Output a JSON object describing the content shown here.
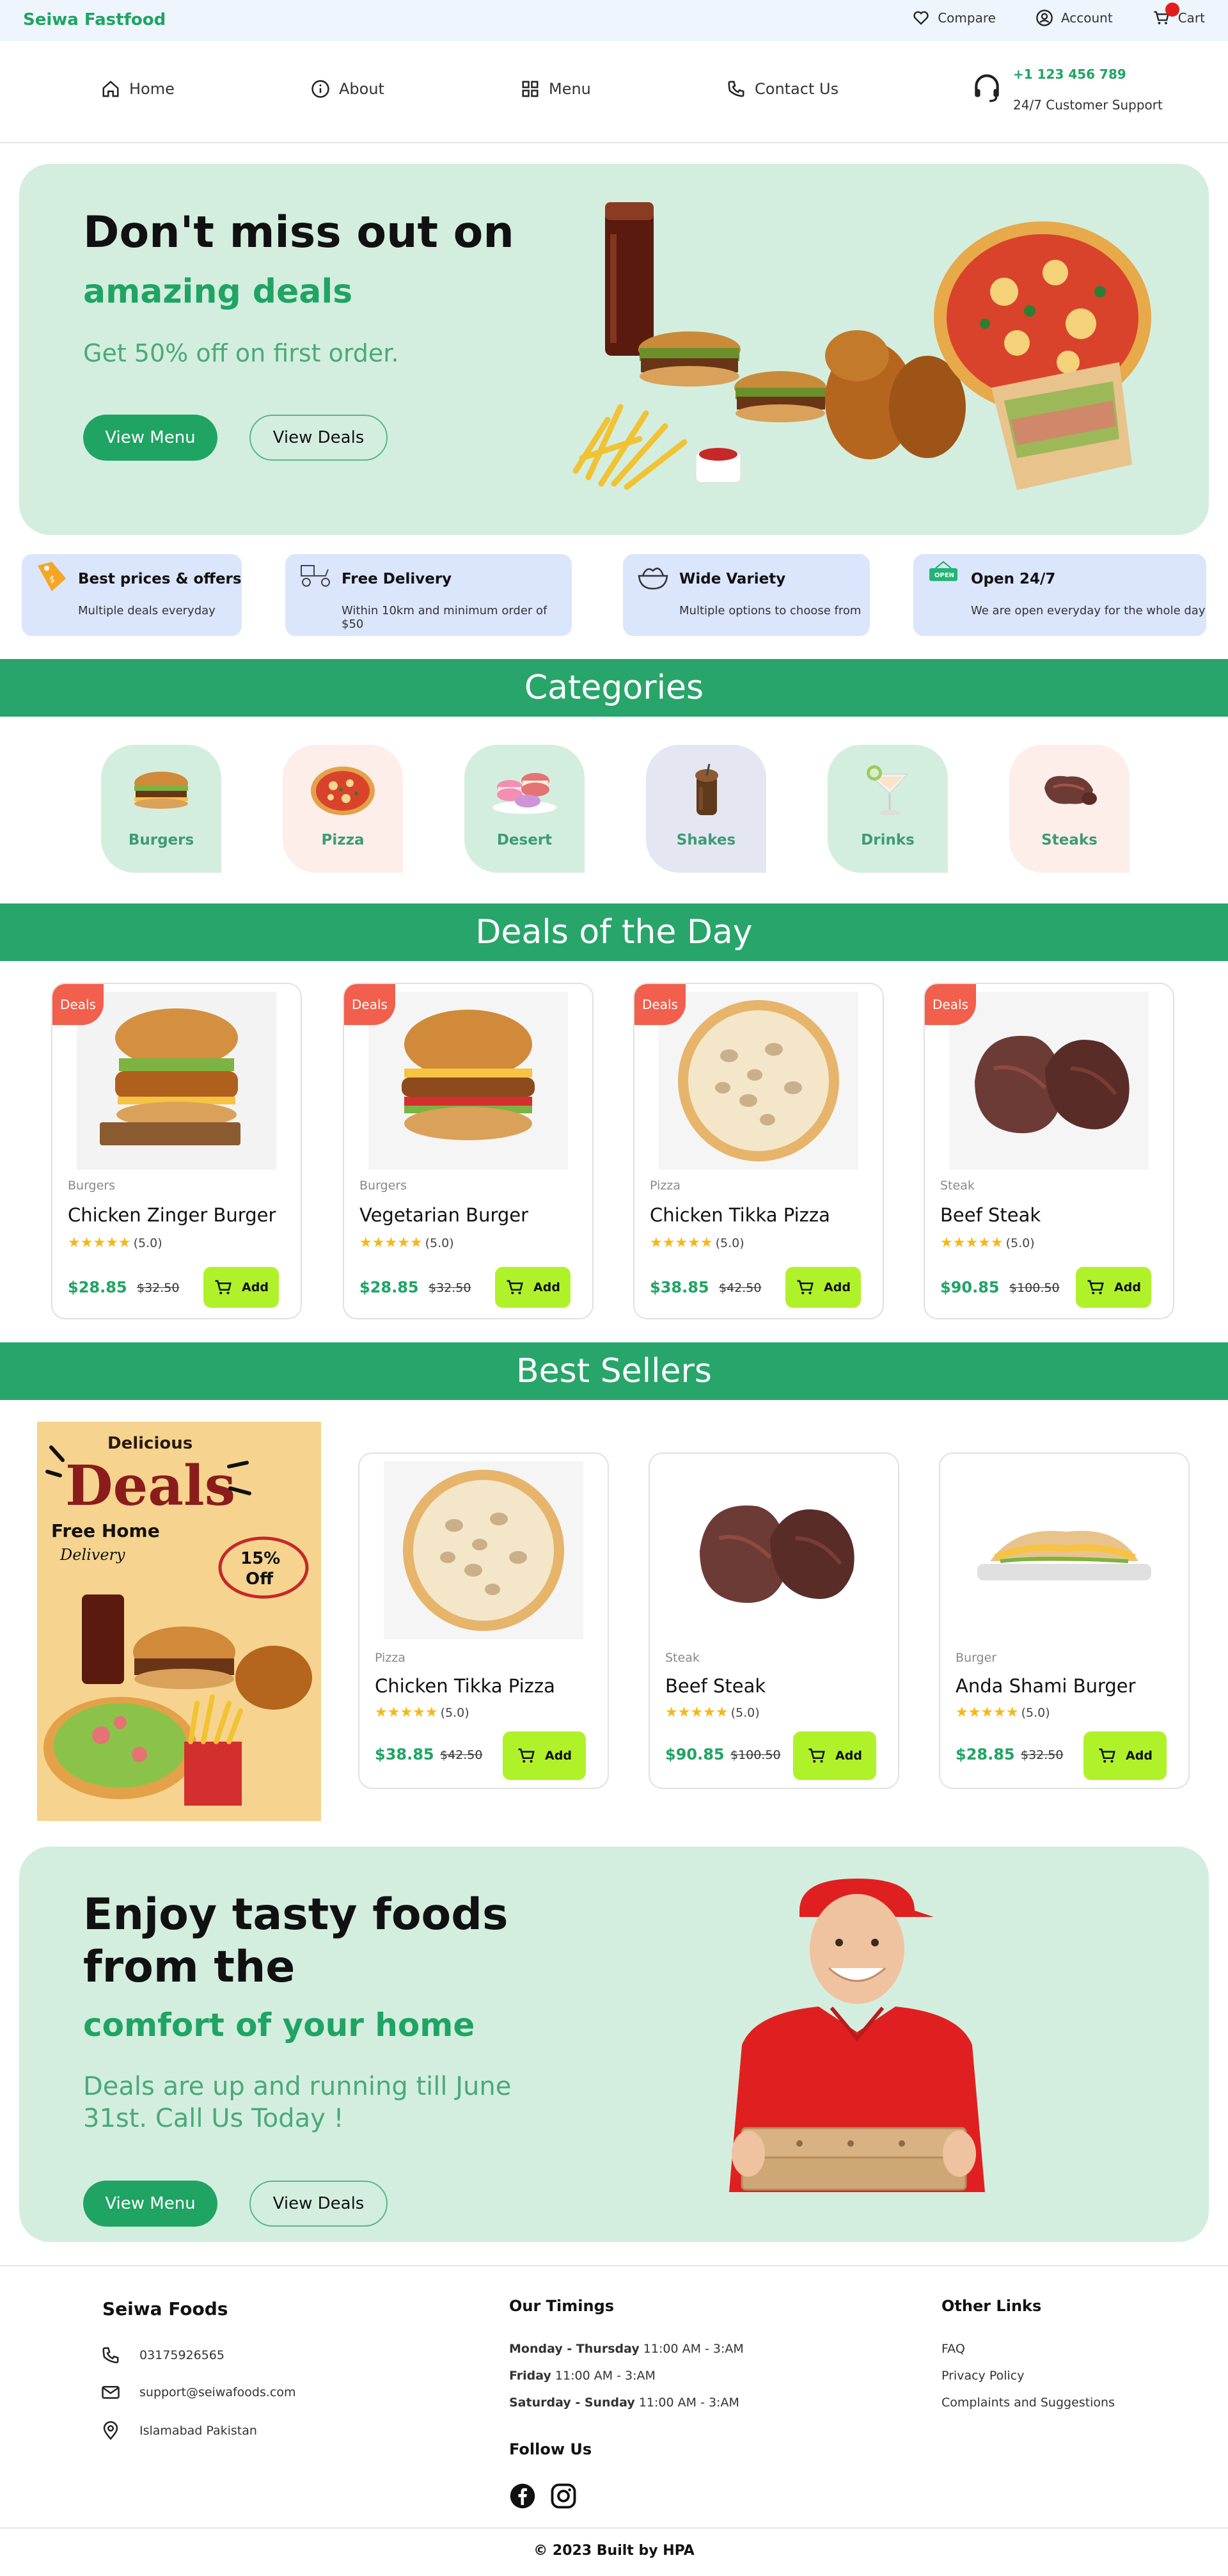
{
  "topbar": {
    "brand": "Seiwa Fastfood",
    "links": {
      "compare": "Compare",
      "account": "Account",
      "cart": "Cart"
    },
    "icons": [
      "heart-icon",
      "account-icon",
      "cart-icon"
    ]
  },
  "nav": {
    "home": "Home",
    "about": "About",
    "menu": "Menu",
    "contact": "Contact Us",
    "support_phone": "+1 123 456 789",
    "support_label": "24/7 Customer Support"
  },
  "hero": {
    "title": "Don't miss out on",
    "accent": "amazing deals",
    "subtitle": "Get 50% off on first order.",
    "view_menu": "View Menu",
    "view_deals": "View Deals"
  },
  "features": [
    {
      "title": "Best prices & offers",
      "subtitle": "Multiple deals everyday",
      "icon": "price-tag-icon"
    },
    {
      "title": "Free Delivery",
      "subtitle": "Within 10km and minimum order of $50",
      "icon": "delivery-scooter-icon"
    },
    {
      "title": "Wide Variety",
      "subtitle": "Multiple options to choose from",
      "icon": "food-bowl-icon"
    },
    {
      "title": "Open 24/7",
      "subtitle": "We are open everyday for the whole day",
      "icon": "open-sign-icon"
    }
  ],
  "categories_section": {
    "title": "Categories",
    "items": [
      {
        "label": "Burgers",
        "bg": "#d3eedf"
      },
      {
        "label": "Pizza",
        "bg": "#fdeeea"
      },
      {
        "label": "Desert",
        "bg": "#d3eedf"
      },
      {
        "label": "Shakes",
        "bg": "#e4e7f2"
      },
      {
        "label": "Drinks",
        "bg": "#d3eedf"
      },
      {
        "label": "Steaks",
        "bg": "#fdeeea"
      }
    ]
  },
  "deals_section": {
    "title": "Deals of the Day",
    "badge": "Deals",
    "items": [
      {
        "category": "Burgers",
        "name": "Chicken Zinger Burger",
        "rating": "(5.0)",
        "price": "$28.85",
        "old_price": "$32.50",
        "add": "Add"
      },
      {
        "category": "Burgers",
        "name": "Vegetarian Burger",
        "rating": "(5.0)",
        "price": "$28.85",
        "old_price": "$32.50",
        "add": "Add"
      },
      {
        "category": "Pizza",
        "name": "Chicken Tikka Pizza",
        "rating": "(5.0)",
        "price": "$38.85",
        "old_price": "$42.50",
        "add": "Add"
      },
      {
        "category": "Steak",
        "name": "Beef Steak",
        "rating": "(5.0)",
        "price": "$90.85",
        "old_price": "$100.50",
        "add": "Add"
      }
    ]
  },
  "best_sellers_section": {
    "title": "Best Sellers",
    "poster": {
      "line1": "Delicious",
      "line2": "Deals",
      "line3": "Free Home",
      "line4": "Delivery",
      "badge_top": "15%",
      "badge_bottom": "Off"
    },
    "items": [
      {
        "category": "Pizza",
        "name": "Chicken Tikka Pizza",
        "rating": "(5.0)",
        "price": "$38.85",
        "old_price": "$42.50",
        "add": "Add"
      },
      {
        "category": "Steak",
        "name": "Beef Steak",
        "rating": "(5.0)",
        "price": "$90.85",
        "old_price": "$100.50",
        "add": "Add"
      },
      {
        "category": "Burger",
        "name": "Anda Shami Burger",
        "rating": "(5.0)",
        "price": "$28.85",
        "old_price": "$32.50",
        "add": "Add"
      }
    ]
  },
  "hero2": {
    "title_line1": "Enjoy tasty foods",
    "title_line2": "from the",
    "accent": "comfort of your home",
    "subtitle_line1": "Deals are up and running till June",
    "subtitle_line2": "31st. Call Us Today !",
    "view_menu": "View Menu",
    "view_deals": "View Deals"
  },
  "footer": {
    "brand": "Seiwa Foods",
    "phone": "03175926565",
    "email": "support@seiwafoods.com",
    "location": "Islamabad Pakistan",
    "timings_title": "Our Timings",
    "timings": [
      {
        "days": "Monday - Thursday",
        "hours": "11:00 AM - 3:AM"
      },
      {
        "days": "Friday",
        "hours": "11:00 AM - 3:AM"
      },
      {
        "days": "Saturday - Sunday",
        "hours": "11:00 AM - 3:AM"
      }
    ],
    "follow_title": "Follow Us",
    "other_title": "Other Links",
    "links": [
      "FAQ",
      "Privacy Policy",
      "Complaints and Suggestions"
    ],
    "copyright": "© 2023 Built by HPA"
  },
  "colors": {
    "primary": "#1fa463",
    "section_bar": "#28a56a",
    "hero_bg": "#d3eedf",
    "feature_bg": "#dbe5fc",
    "add_button": "#b0f22a",
    "badge": "#f25f4c",
    "star": "#f5b71a"
  }
}
